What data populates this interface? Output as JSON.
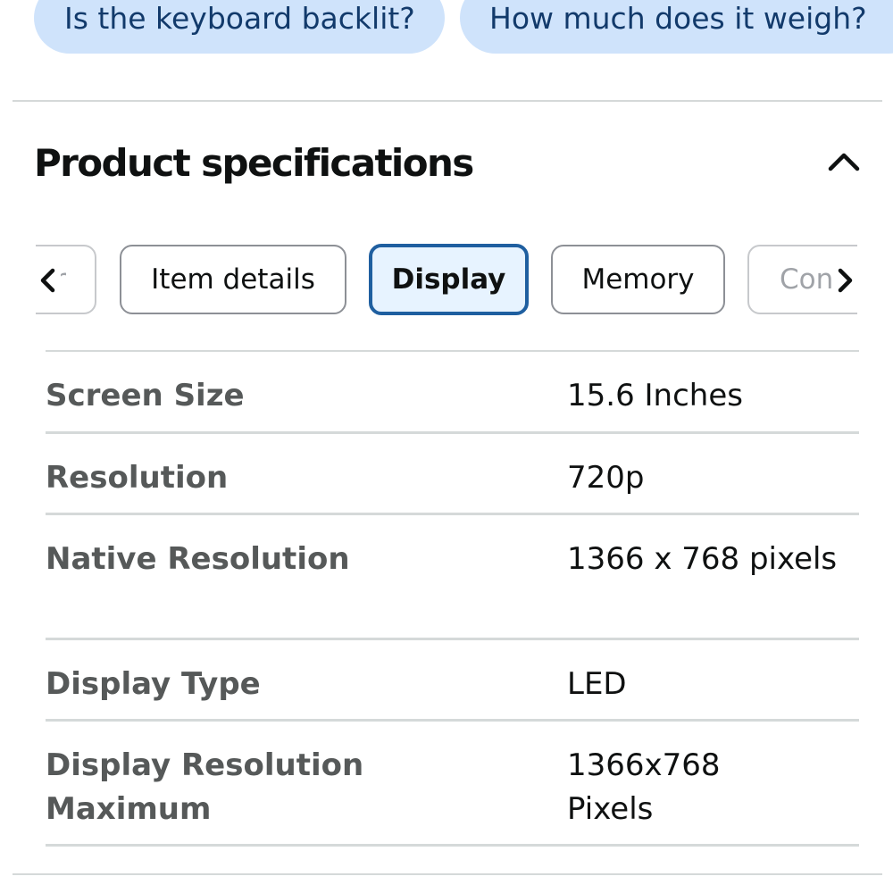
{
  "suggested_questions": [
    {
      "label": "Is the keyboard backlit?"
    },
    {
      "label": "How much does it weigh?"
    }
  ],
  "section": {
    "title": "Product specifications",
    "toggle_icon": "chevron-up-icon",
    "expanded": true
  },
  "tabs": {
    "scroll_left_icon": "chevron-left-icon",
    "scroll_right_icon": "chevron-right-icon",
    "items": [
      {
        "label": "r",
        "selected": false
      },
      {
        "label": "Item details",
        "selected": false
      },
      {
        "label": "Display",
        "selected": true
      },
      {
        "label": "Memory",
        "selected": false
      },
      {
        "label": "Con",
        "selected": false
      }
    ]
  },
  "specs": [
    {
      "key": "Screen Size",
      "value": "15.6 Inches"
    },
    {
      "key": "Resolution",
      "value": "720p"
    },
    {
      "key": "Native Resolution",
      "value": "1366 x 768 pixels"
    },
    {
      "key": "Display Type",
      "value": "LED"
    },
    {
      "key": "Display Resolution Maximum",
      "value": "1366x768 Pixels"
    }
  ],
  "colors": {
    "chip_background": "#cfe3fb",
    "chip_text": "#123a6b",
    "selected_tab_border": "#1f5fa0",
    "selected_tab_background": "#e7f3ff",
    "divider": "#d5d9d9",
    "spec_key_text": "#565959"
  }
}
